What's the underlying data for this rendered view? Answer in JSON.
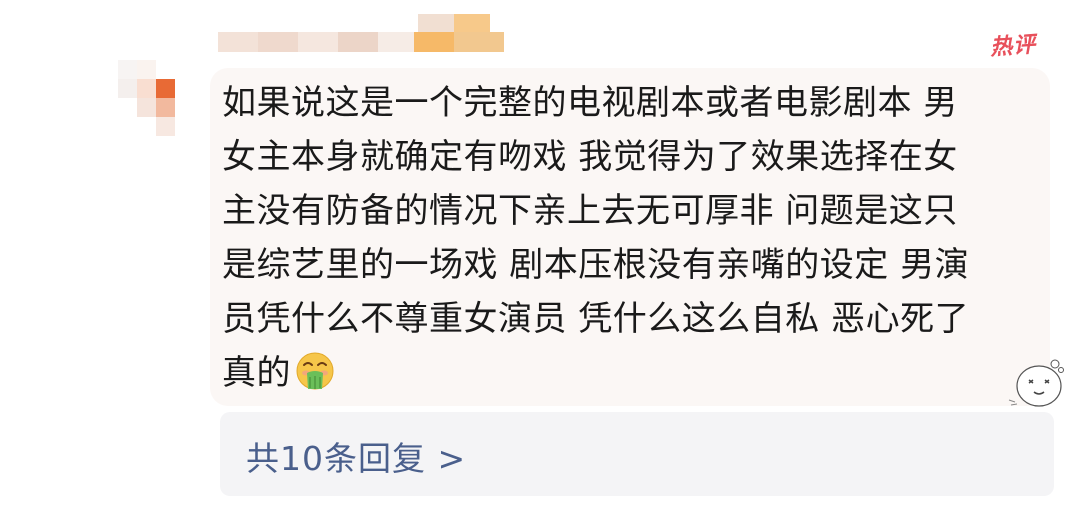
{
  "comment": {
    "username": "",
    "badge": "热评",
    "lines": [
      "如果说这是一个完整的电视剧本或者电影剧本 男",
      "女主本身就确定有吻戏 我觉得为了效果选择在女",
      "主没有防备的情况下亲上去无可厚非 问题是这只",
      "是综艺里的一场戏 剧本压根没有亲嘴的设定 男演",
      "员凭什么不尊重女演员 凭什么这么自私 恶心死了",
      "真的"
    ],
    "emoji": "vomiting-face-emoji"
  },
  "replies": {
    "label": "共10条回复 >"
  },
  "colors": {
    "badge": "#e8505b",
    "reply_link": "#4a5f8c",
    "bubble_bg": "#fbf7f5",
    "replies_bg": "#f4f4f6"
  }
}
